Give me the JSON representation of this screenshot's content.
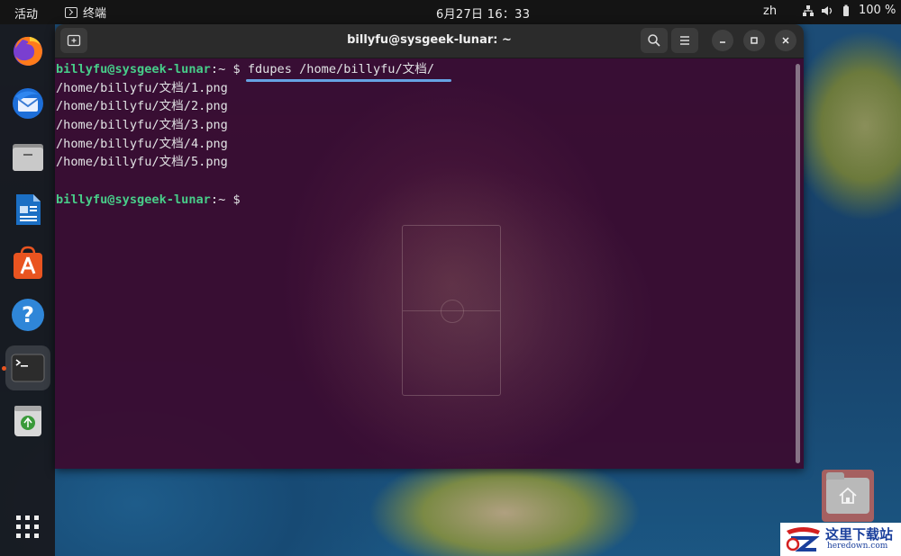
{
  "topbar": {
    "activities": "活动",
    "app_name": "终端",
    "clock": "6月27日  16：33",
    "input_language": "zh",
    "battery": "100 %",
    "icons": [
      "network-icon",
      "volume-icon",
      "battery-icon"
    ]
  },
  "dock": {
    "items": [
      {
        "name": "firefox",
        "icon": "firefox-icon"
      },
      {
        "name": "thunderbird",
        "icon": "thunderbird-icon"
      },
      {
        "name": "files",
        "icon": "files-icon"
      },
      {
        "name": "libreoffice-writer",
        "icon": "writer-icon"
      },
      {
        "name": "app-center",
        "icon": "app-center-icon"
      },
      {
        "name": "help",
        "icon": "help-icon"
      },
      {
        "name": "terminal",
        "icon": "terminal-icon",
        "active": true
      },
      {
        "name": "trash",
        "icon": "trash-icon"
      },
      {
        "name": "show-apps",
        "icon": "app-grid-icon"
      }
    ]
  },
  "terminal": {
    "title": "billyfu@sysgeek-lunar: ~",
    "prompt_user": "billyfu@sysgeek-lunar",
    "prompt_sep": ":",
    "prompt_path": "~",
    "prompt_symbol": "$",
    "command": "fdupes /home/billyfu/文档/",
    "output": [
      "/home/billyfu/文档/1.png",
      "/home/billyfu/文档/2.png",
      "/home/billyfu/文档/3.png",
      "/home/billyfu/文档/4.png",
      "/home/billyfu/文档/5.png"
    ],
    "colors": {
      "background": "#3a0d32",
      "prompt": "#4ad28a",
      "text": "#e8e8e8",
      "highlight": "#6aa7e8"
    }
  },
  "desktop": {
    "home_icon": "home-folder-icon"
  },
  "watermark": {
    "text": "这里下载站",
    "sub": "heredown.com"
  }
}
